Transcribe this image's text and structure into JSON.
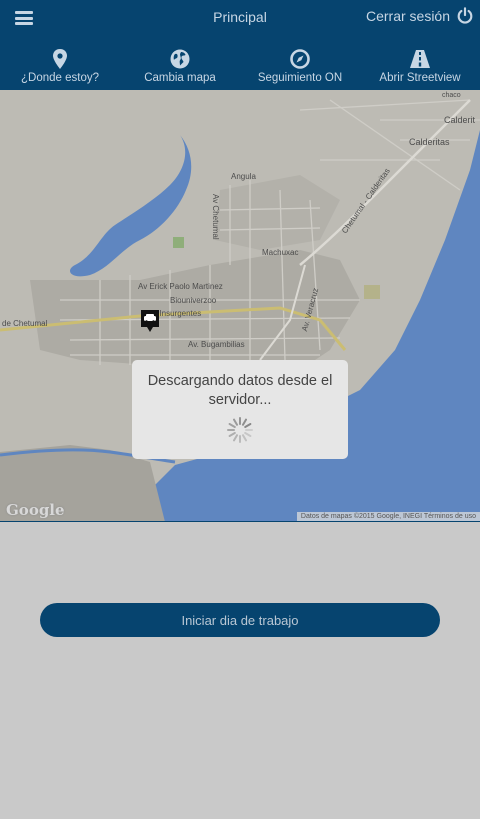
{
  "header": {
    "title": "Principal",
    "logout_label": "Cerrar sesión",
    "actions": [
      {
        "label": "¿Donde estoy?",
        "icon": "location-pin-icon"
      },
      {
        "label": "Cambia mapa",
        "icon": "globe-icon"
      },
      {
        "label": "Seguimiento ON",
        "icon": "compass-icon"
      },
      {
        "label": "Abrir Streetview",
        "icon": "road-icon"
      }
    ]
  },
  "map": {
    "labels": {
      "calderitas_1": "Calderit",
      "calderitas_2": "Calderitas",
      "angula": "Angula",
      "av_chetumal": "Av Chetumal",
      "calderitas_road": "Chetumal - Calderitas",
      "machuxac": "Machuxac",
      "erick_paolo": "Av Erick Paolo Martinez",
      "biouniverzoo": "Biouniverzoo",
      "insurgentes": "Av Insurgentes",
      "de_chetumal": "de Chetumal",
      "bugambilias": "Av. Bugambilias",
      "veracruz": "Av. Veracruz",
      "chaco": "chaco"
    },
    "google_logo": "Google",
    "attribution": "Datos de mapas ©2015 Google, INEGI   Términos de uso"
  },
  "dialog": {
    "message": "Descargando datos desde el servidor..."
  },
  "main": {
    "start_button": "Iniciar dia de trabajo"
  },
  "colors": {
    "header_bg": "#06446f",
    "water": "#5f86c0",
    "land": "#bdbbb4"
  }
}
